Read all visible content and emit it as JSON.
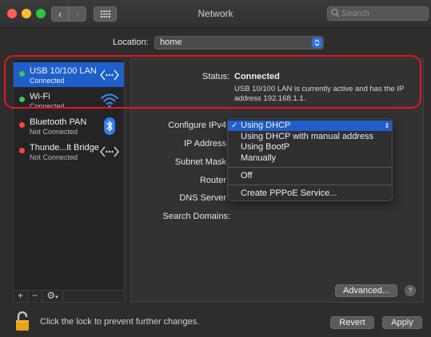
{
  "window": {
    "title": "Network"
  },
  "search": {
    "placeholder": "Search"
  },
  "location": {
    "label": "Location:",
    "value": "home"
  },
  "services": [
    {
      "name": "USB 10/100 LAN",
      "status": "Connected",
      "state": "green",
      "icon": "ethernet-arrows-icon",
      "selected": true
    },
    {
      "name": "Wi-Fi",
      "status": "Connected",
      "state": "green",
      "icon": "wifi-icon",
      "selected": false
    },
    {
      "name": "Bluetooth PAN",
      "status": "Not Connected",
      "state": "red",
      "icon": "bluetooth-icon",
      "selected": false
    },
    {
      "name": "Thunde...lt Bridge",
      "status": "Not Connected",
      "state": "red",
      "icon": "ethernet-arrows-icon",
      "selected": false
    }
  ],
  "sidebar_toolbar": {
    "add": "+",
    "remove": "−",
    "gear": "⚙"
  },
  "detail": {
    "status_label": "Status:",
    "status_value": "Connected",
    "status_desc": "USB 10/100 LAN is currently active and has the IP address 192.168.1.1.",
    "labels": {
      "configure": "Configure IPv4",
      "ip": "IP Address",
      "subnet": "Subnet Mask",
      "router": "Router",
      "dns": "DNS Server",
      "search_domains": "Search Domains:"
    }
  },
  "configure_menu": {
    "items": [
      "Using DHCP",
      "Using DHCP with manual address",
      "Using BootP",
      "Manually",
      "Off",
      "Create PPPoE Service..."
    ],
    "selected_index": 0
  },
  "buttons": {
    "advanced": "Advanced...",
    "help": "?",
    "revert": "Revert",
    "apply": "Apply"
  },
  "lock_text": "Click the lock to prevent further changes.",
  "colors": {
    "accent": "#1f5fc9",
    "connected": "#35c759",
    "disconnected": "#ff453a",
    "annotation": "#e0181c"
  }
}
